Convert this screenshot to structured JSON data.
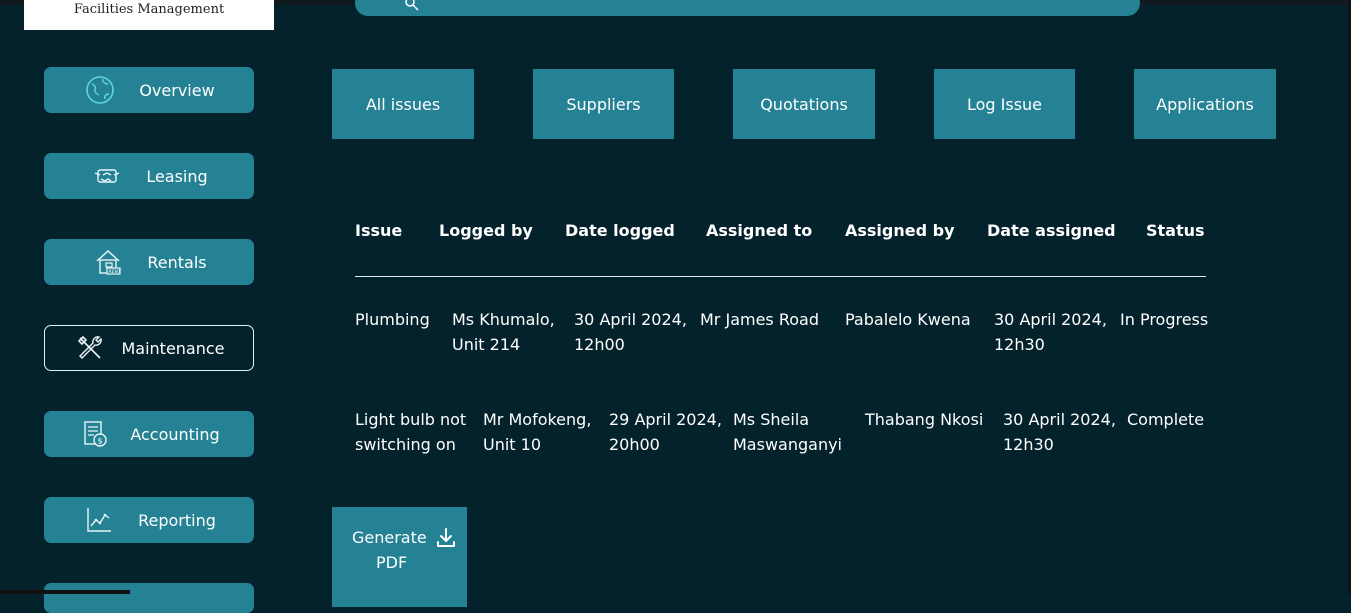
{
  "brand": {
    "logo_text": "Facilities Management"
  },
  "search": {
    "icon": "search-icon"
  },
  "sidebar": {
    "items": [
      {
        "label": "Overview",
        "icon": "globe-icon"
      },
      {
        "label": "Leasing",
        "icon": "handshake-icon"
      },
      {
        "label": "Rentals",
        "icon": "rent-house-icon"
      },
      {
        "label": "Maintenance",
        "icon": "tools-icon",
        "active": true
      },
      {
        "label": "Accounting",
        "icon": "ledger-icon"
      },
      {
        "label": "Reporting",
        "icon": "chart-icon"
      }
    ]
  },
  "tabs": [
    "All issues",
    "Suppliers",
    "Quotations",
    "Log Issue",
    "Applications"
  ],
  "table": {
    "headers": [
      "Issue",
      "Logged by",
      "Date logged",
      "Assigned to",
      "Assigned by",
      "Date assigned",
      "Status"
    ],
    "rows": [
      {
        "issue": [
          "Plumbing",
          ""
        ],
        "logged_by": [
          "Ms Khumalo,",
          "Unit 214"
        ],
        "date_logged": [
          "30 April 2024,",
          "12h00"
        ],
        "assigned_to": [
          "Mr James Road",
          ""
        ],
        "assigned_by": [
          "Pabalelo Kwena",
          ""
        ],
        "date_assigned": [
          "30 April 2024,",
          "12h30"
        ],
        "status": "In Progress"
      },
      {
        "issue": [
          "Light bulb not",
          "switching on"
        ],
        "logged_by": [
          "Mr Mofokeng,",
          "Unit 10"
        ],
        "date_logged": [
          "29 April 2024,",
          "20h00"
        ],
        "assigned_to": [
          "Ms Sheila",
          "Maswanganyi"
        ],
        "assigned_by": [
          "Thabang Nkosi",
          ""
        ],
        "date_assigned": [
          "30 April 2024,",
          "12h30"
        ],
        "status": "Complete"
      }
    ]
  },
  "actions": {
    "generate_pdf_line1": "Generate",
    "generate_pdf_line2": "PDF",
    "icon": "download-icon"
  },
  "colors": {
    "background": "#04222c",
    "accent": "#248294",
    "text": "#ffffff"
  }
}
